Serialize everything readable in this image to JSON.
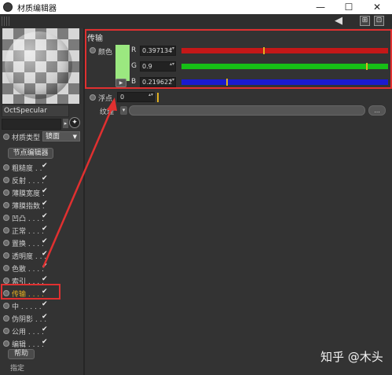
{
  "window": {
    "title": "材质编辑器",
    "controls": {
      "minimize": "—",
      "maximize": "☐",
      "close": "✕"
    }
  },
  "toolbar": {
    "back_arrow": "◀",
    "btn1": "⊞",
    "btn2": "⊡"
  },
  "left": {
    "material_name": "OctSpecular",
    "pick_icon": "✦",
    "small_arrow": "▸",
    "material_type_label": "材质类型",
    "material_type_value": "镜面",
    "node_editor_button": "节点编辑器",
    "params": [
      {
        "label": "粗糙度 . .",
        "checked": true,
        "active": false
      },
      {
        "label": "反射 . . . .",
        "checked": true,
        "active": false
      },
      {
        "label": "薄膜宽度 .",
        "checked": true,
        "active": false
      },
      {
        "label": "薄膜指数 .",
        "checked": true,
        "active": false
      },
      {
        "label": "凹凸 . . . .",
        "checked": true,
        "active": false
      },
      {
        "label": "正常 . . . .",
        "checked": true,
        "active": false
      },
      {
        "label": "置换 . . . .",
        "checked": true,
        "active": false
      },
      {
        "label": "透明度 . . .",
        "checked": true,
        "active": false
      },
      {
        "label": "色散 . . . .",
        "checked": true,
        "active": false
      },
      {
        "label": "索引 . . . .",
        "checked": true,
        "active": false
      },
      {
        "label": "传输 . . . .",
        "checked": true,
        "active": true
      },
      {
        "label": "中 . . . . .",
        "checked": true,
        "active": false
      },
      {
        "label": "伪阴影 . . .",
        "checked": true,
        "active": false
      },
      {
        "label": "公用 . . . .",
        "checked": true,
        "active": false
      },
      {
        "label": "编辑 . . . .",
        "checked": true,
        "active": false
      }
    ],
    "check_glyph": "✔",
    "help_button": "帮助",
    "assign_label": "指定"
  },
  "right": {
    "section_title": "传输",
    "color_label": "颜色",
    "swatch_color": "#9be880",
    "channels": [
      {
        "name": "R",
        "value": "0.397134",
        "level": 0.397,
        "color": "#c41818"
      },
      {
        "name": "G",
        "value": "0.9",
        "level": 0.9,
        "color": "#16c016"
      },
      {
        "name": "B",
        "value": "0.219622",
        "level": 0.22,
        "color": "#1a1ad0"
      }
    ],
    "spin_glyph": "▴▾",
    "expand_glyph": "▶",
    "float_label": "浮点",
    "float_value": "0",
    "texture_label": "纹理",
    "texture_more": "...",
    "texture_arrow": "▾"
  },
  "annotations": {
    "highlight_color": "#e03030"
  },
  "watermark": "知乎 @木头"
}
